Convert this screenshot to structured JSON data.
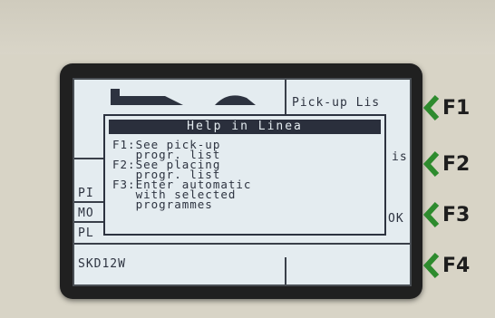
{
  "screen": {
    "header_right": "Pick-up Lis",
    "row2_right": "is",
    "row3_right": "OK",
    "left_rows": [
      "PI",
      "MO",
      "PL"
    ],
    "footer_left": "SKD12W"
  },
  "dialog": {
    "title": "Help in Linea",
    "lines": [
      "F1:See pick-up",
      "   progr. list",
      "F2:See placing",
      "   progr. list",
      "F3:Enter automatic",
      "   with selected",
      "   programmes"
    ]
  },
  "function_keys": [
    "F1",
    "F2",
    "F3",
    "F4"
  ],
  "colors": {
    "accent": "#2e8b2e",
    "lcd_background": "#e4ecf0",
    "lcd_text": "#2d3340"
  }
}
